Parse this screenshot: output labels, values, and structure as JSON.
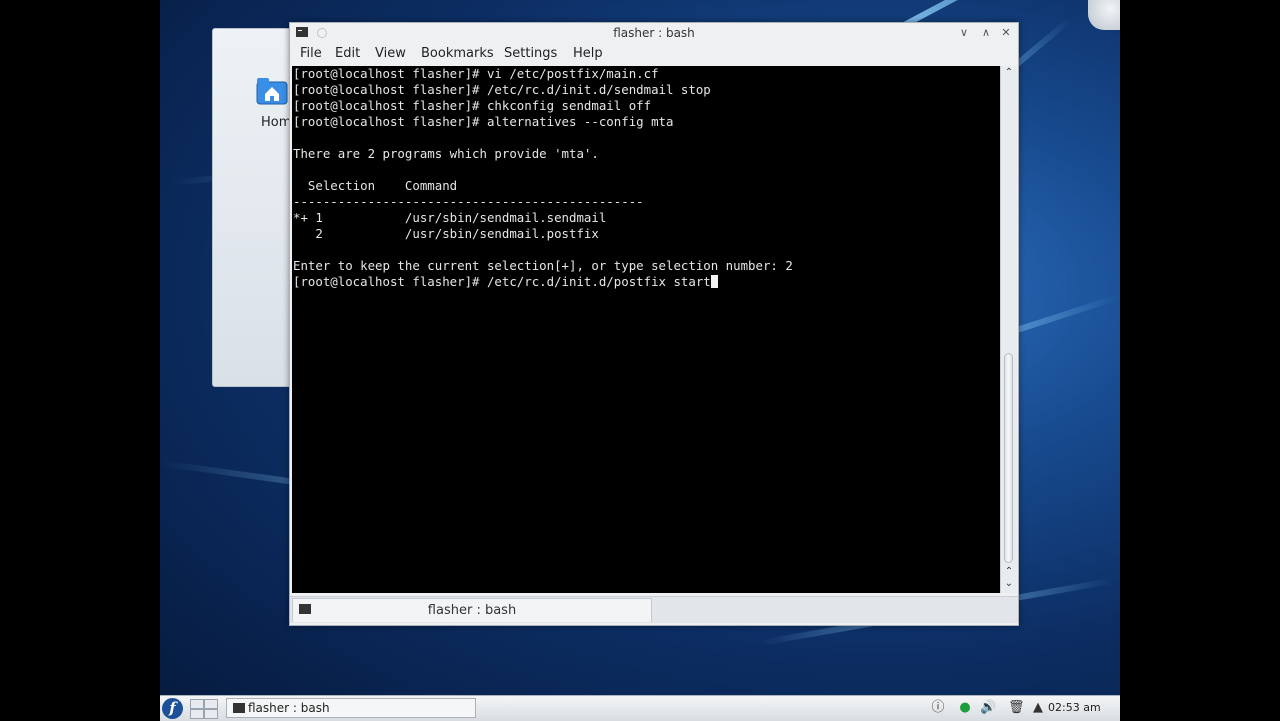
{
  "window": {
    "title": "flasher : bash"
  },
  "desktop": {
    "home_label": "Home"
  },
  "menu": [
    "File",
    "Edit",
    "View",
    "Bookmarks",
    "Settings",
    "Help"
  ],
  "terminal": {
    "lines": [
      "[root@localhost flasher]# vi /etc/postfix/main.cf",
      "[root@localhost flasher]# /etc/rc.d/init.d/sendmail stop",
      "[root@localhost flasher]# chkconfig sendmail off",
      "[root@localhost flasher]# alternatives --config mta",
      "",
      "There are 2 programs which provide 'mta'.",
      "",
      "  Selection    Command",
      "-----------------------------------------------",
      "*+ 1           /usr/sbin/sendmail.sendmail",
      "   2           /usr/sbin/sendmail.postfix",
      "",
      "Enter to keep the current selection[+], or type selection number: 2"
    ],
    "prompt_line": "[root@localhost flasher]# /etc/rc.d/init.d/postfix start"
  },
  "tab": {
    "label": "flasher : bash"
  },
  "taskbar": {
    "task_label": "flasher : bash",
    "clock": "02:53 am"
  },
  "icons": {
    "start": "fedora-logo-icon",
    "terminal": "terminal-icon",
    "tray": [
      "info-icon",
      "network-icon",
      "volume-icon",
      "trash-icon",
      "arrow-up-icon"
    ]
  }
}
